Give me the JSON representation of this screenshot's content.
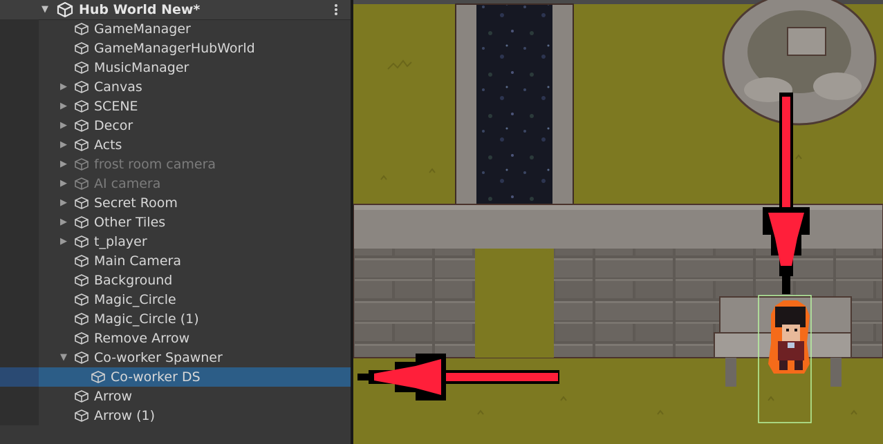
{
  "hierarchy": {
    "scene_title": "Hub World New*",
    "items": [
      {
        "label": "GameManager",
        "expandable": false,
        "indent": 0,
        "inactive": false
      },
      {
        "label": "GameManagerHubWorld",
        "expandable": false,
        "indent": 0,
        "inactive": false
      },
      {
        "label": "MusicManager",
        "expandable": false,
        "indent": 0,
        "inactive": false
      },
      {
        "label": "Canvas",
        "expandable": true,
        "indent": 0,
        "inactive": false
      },
      {
        "label": "SCENE",
        "expandable": true,
        "indent": 0,
        "inactive": false
      },
      {
        "label": "Decor",
        "expandable": true,
        "indent": 0,
        "inactive": false
      },
      {
        "label": "Acts",
        "expandable": true,
        "indent": 0,
        "inactive": false
      },
      {
        "label": "frost room camera",
        "expandable": true,
        "indent": 0,
        "inactive": true
      },
      {
        "label": "AI camera",
        "expandable": true,
        "indent": 0,
        "inactive": true
      },
      {
        "label": "Secret Room",
        "expandable": true,
        "indent": 0,
        "inactive": false
      },
      {
        "label": "Other Tiles",
        "expandable": true,
        "indent": 0,
        "inactive": false
      },
      {
        "label": "t_player",
        "expandable": true,
        "indent": 0,
        "inactive": false
      },
      {
        "label": "Main Camera",
        "expandable": false,
        "indent": 0,
        "inactive": false
      },
      {
        "label": "Background",
        "expandable": false,
        "indent": 0,
        "inactive": false
      },
      {
        "label": "Magic_Circle",
        "expandable": false,
        "indent": 0,
        "inactive": false
      },
      {
        "label": "Magic_Circle (1)",
        "expandable": false,
        "indent": 0,
        "inactive": false
      },
      {
        "label": "Remove Arrow",
        "expandable": false,
        "indent": 0,
        "inactive": false
      },
      {
        "label": "Co-worker Spawner",
        "expandable": true,
        "expanded": true,
        "indent": 0,
        "inactive": false
      },
      {
        "label": "Co-worker DS",
        "expandable": false,
        "indent": 1,
        "inactive": false,
        "selected": true
      },
      {
        "label": "Arrow",
        "expandable": false,
        "indent": 0,
        "inactive": false
      },
      {
        "label": "Arrow (1)",
        "expandable": false,
        "indent": 0,
        "inactive": false
      }
    ]
  },
  "scene_view": {
    "selection_outline_color": "#b8f5a0",
    "arrow_color": "#ff1f3a"
  },
  "icons": {
    "fold_collapsed": "▶",
    "fold_expanded": "▼"
  }
}
